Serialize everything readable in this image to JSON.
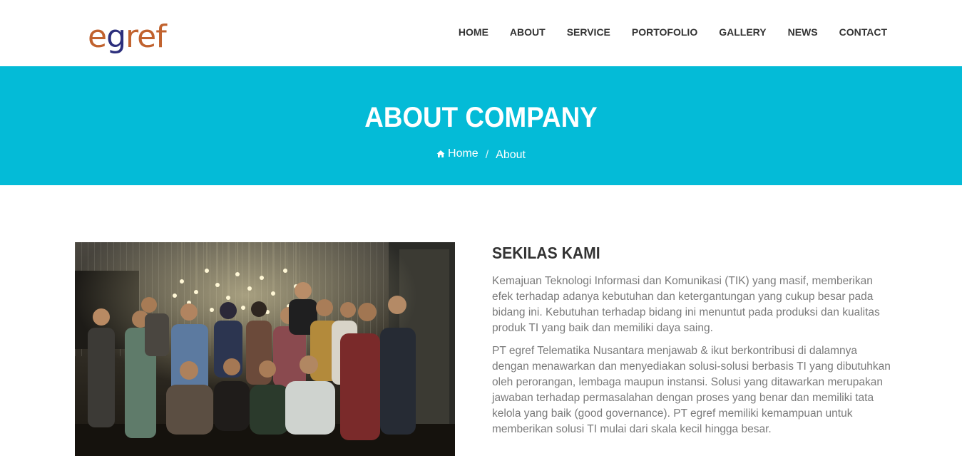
{
  "header": {
    "logo": {
      "e": "e",
      "g": "g",
      "ref": "ref"
    },
    "nav": [
      "HOME",
      "ABOUT",
      "SERVICE",
      "PORTOFOLIO",
      "GALLERY",
      "NEWS",
      "CONTACT"
    ]
  },
  "banner": {
    "title": "ABOUT COMPANY",
    "breadcrumb": {
      "home": "Home",
      "separator": "/",
      "current": "About"
    },
    "color": "#04bbd7"
  },
  "about": {
    "title": "SEKILAS KAMI",
    "paragraphs": [
      "Kemajuan Teknologi Informasi dan Komunikasi (TIK) yang masif, memberikan efek terhadap adanya kebutuhan dan ketergantungan yang cukup besar pada bidang ini. Kebutuhan terhadap bidang ini menuntut pada produksi dan kualitas produk TI yang baik dan memiliki daya saing.",
      "PT egref Telematika Nusantara menjawab & ikut berkontribusi di dalamnya dengan menawarkan dan menyediakan solusi-solusi berbasis TI yang dibutuhkan oleh perorangan, lembaga maupun instansi. Solusi yang ditawarkan merupakan jawaban terhadap permasalahan dengan proses yang benar dan memiliki tata kelola yang baik (good governance). PT egref memiliki kemampuan untuk memberikan solusi TI mulai dari skala kecil hingga besar."
    ]
  }
}
